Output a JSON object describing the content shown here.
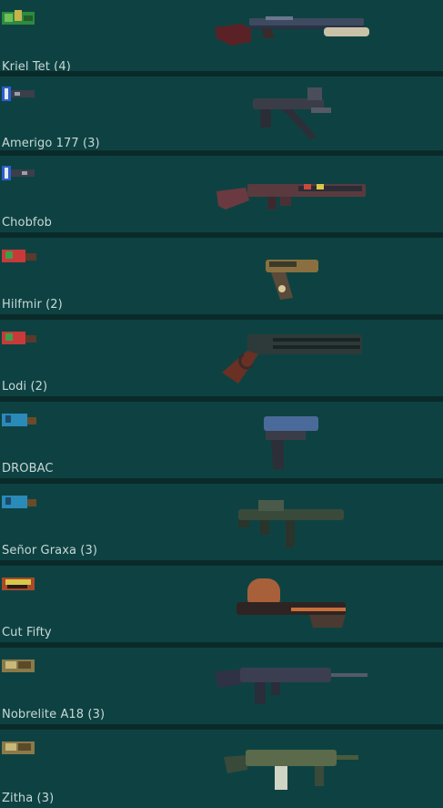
{
  "items": [
    {
      "name": "Kriel Tet (4)",
      "badge_icon": "rarity-badge-icon",
      "weapon_icon": "pump-shotgun-icon"
    },
    {
      "name": "Amerigo 177 (3)",
      "badge_icon": "rarity-badge-icon",
      "weapon_icon": "submachine-gun-icon"
    },
    {
      "name": "Chobfob",
      "badge_icon": "rarity-badge-icon",
      "weapon_icon": "assault-rifle-icon"
    },
    {
      "name": "Hilfmir (2)",
      "badge_icon": "rarity-badge-icon",
      "weapon_icon": "pistol-icon"
    },
    {
      "name": "Lodi (2)",
      "badge_icon": "rarity-badge-icon",
      "weapon_icon": "lever-shotgun-icon"
    },
    {
      "name": "DROBAC",
      "badge_icon": "rarity-badge-icon",
      "weapon_icon": "pistol-icon"
    },
    {
      "name": "Señor Graxa (3)",
      "badge_icon": "rarity-badge-icon",
      "weapon_icon": "submachine-gun-icon"
    },
    {
      "name": "Cut Fifty",
      "badge_icon": "rarity-badge-icon",
      "weapon_icon": "drum-rifle-icon"
    },
    {
      "name": "Nobrelite A18 (3)",
      "badge_icon": "rarity-badge-icon",
      "weapon_icon": "assault-rifle-icon"
    },
    {
      "name": "Zitha (3)",
      "badge_icon": "rarity-badge-icon",
      "weapon_icon": "assault-rifle-icon"
    }
  ],
  "colors": {
    "background": "#0c3333",
    "row": "#0e4242",
    "divider": "#0a2a2a",
    "label_text": "#c9d7d7"
  }
}
